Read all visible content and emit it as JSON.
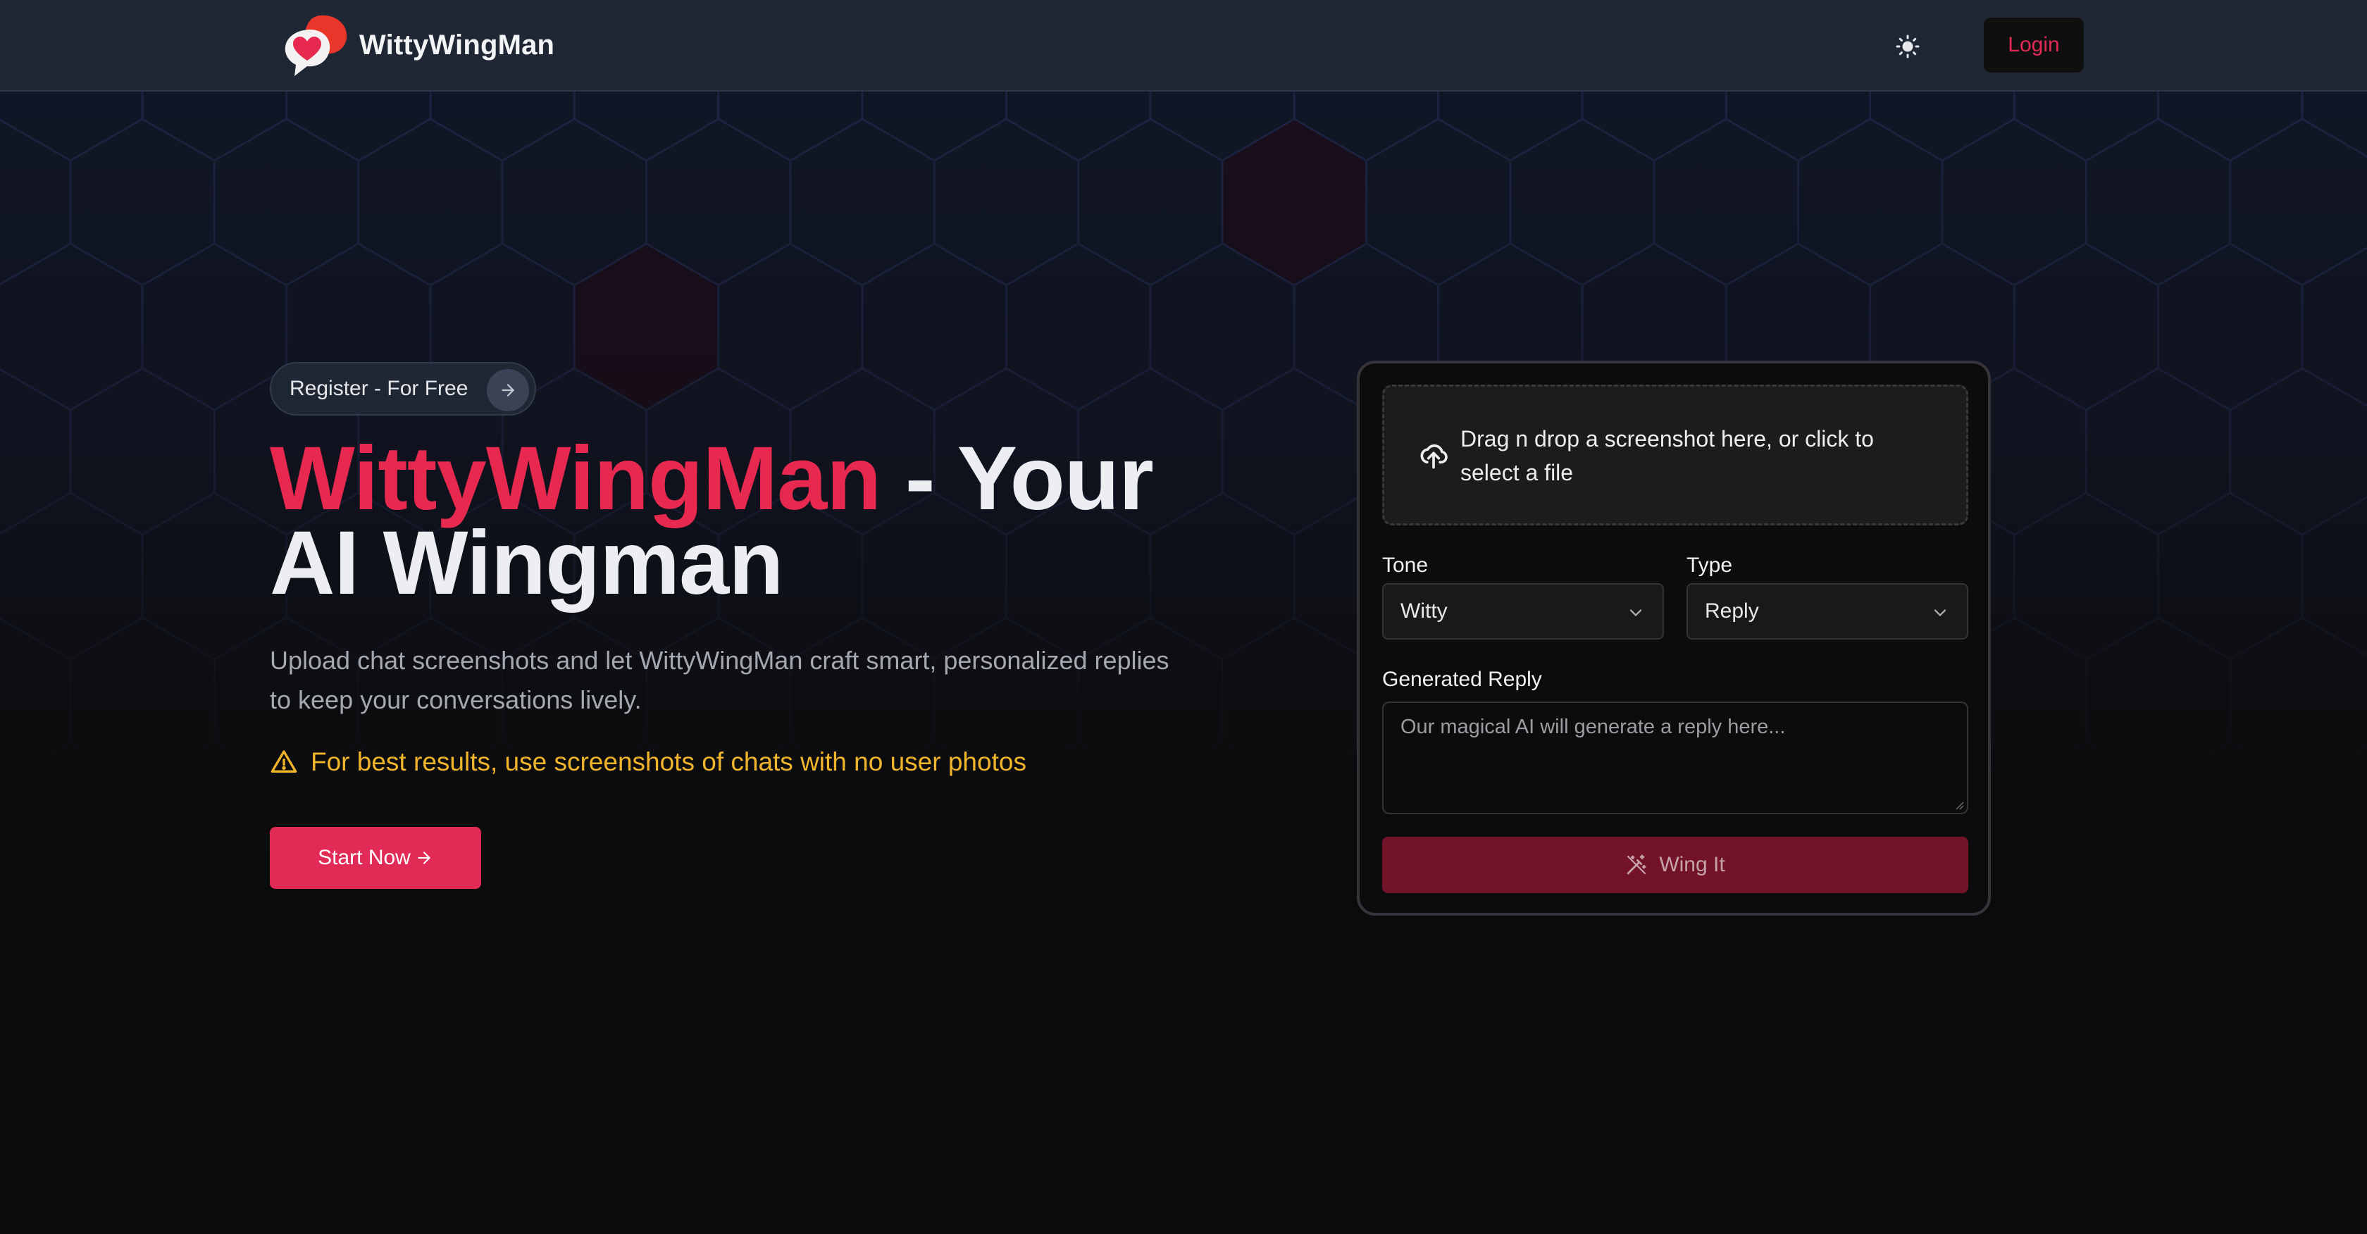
{
  "header": {
    "brand": "WittyWingMan",
    "logo_icon": "chat-bubbles-heart-icon",
    "theme_icon": "sun-icon",
    "login_label": "Login"
  },
  "hero": {
    "register_pill": "Register - For Free",
    "title_accent": "WittyWingMan",
    "title_rest": " - Your AI Wingman",
    "subtitle": "Upload chat screenshots and let WittyWingMan craft smart, personalized replies to keep your conversations lively.",
    "warning": "For best results, use screenshots of chats with no user photos",
    "start_label": "Start Now"
  },
  "card": {
    "dropzone_text": "Drag n drop a screenshot here, or click to select a file",
    "tone_label": "Tone",
    "tone_value": "Witty",
    "type_label": "Type",
    "type_value": "Reply",
    "reply_label": "Generated Reply",
    "reply_placeholder": "Our magical AI will generate a reply here...",
    "wing_label": "Wing It"
  },
  "colors": {
    "accent": "#e8294f",
    "header_bg": "#1f2735",
    "page_bg": "#0c0b0b",
    "warning": "#f1b52b",
    "button_disabled": "#72132a"
  }
}
